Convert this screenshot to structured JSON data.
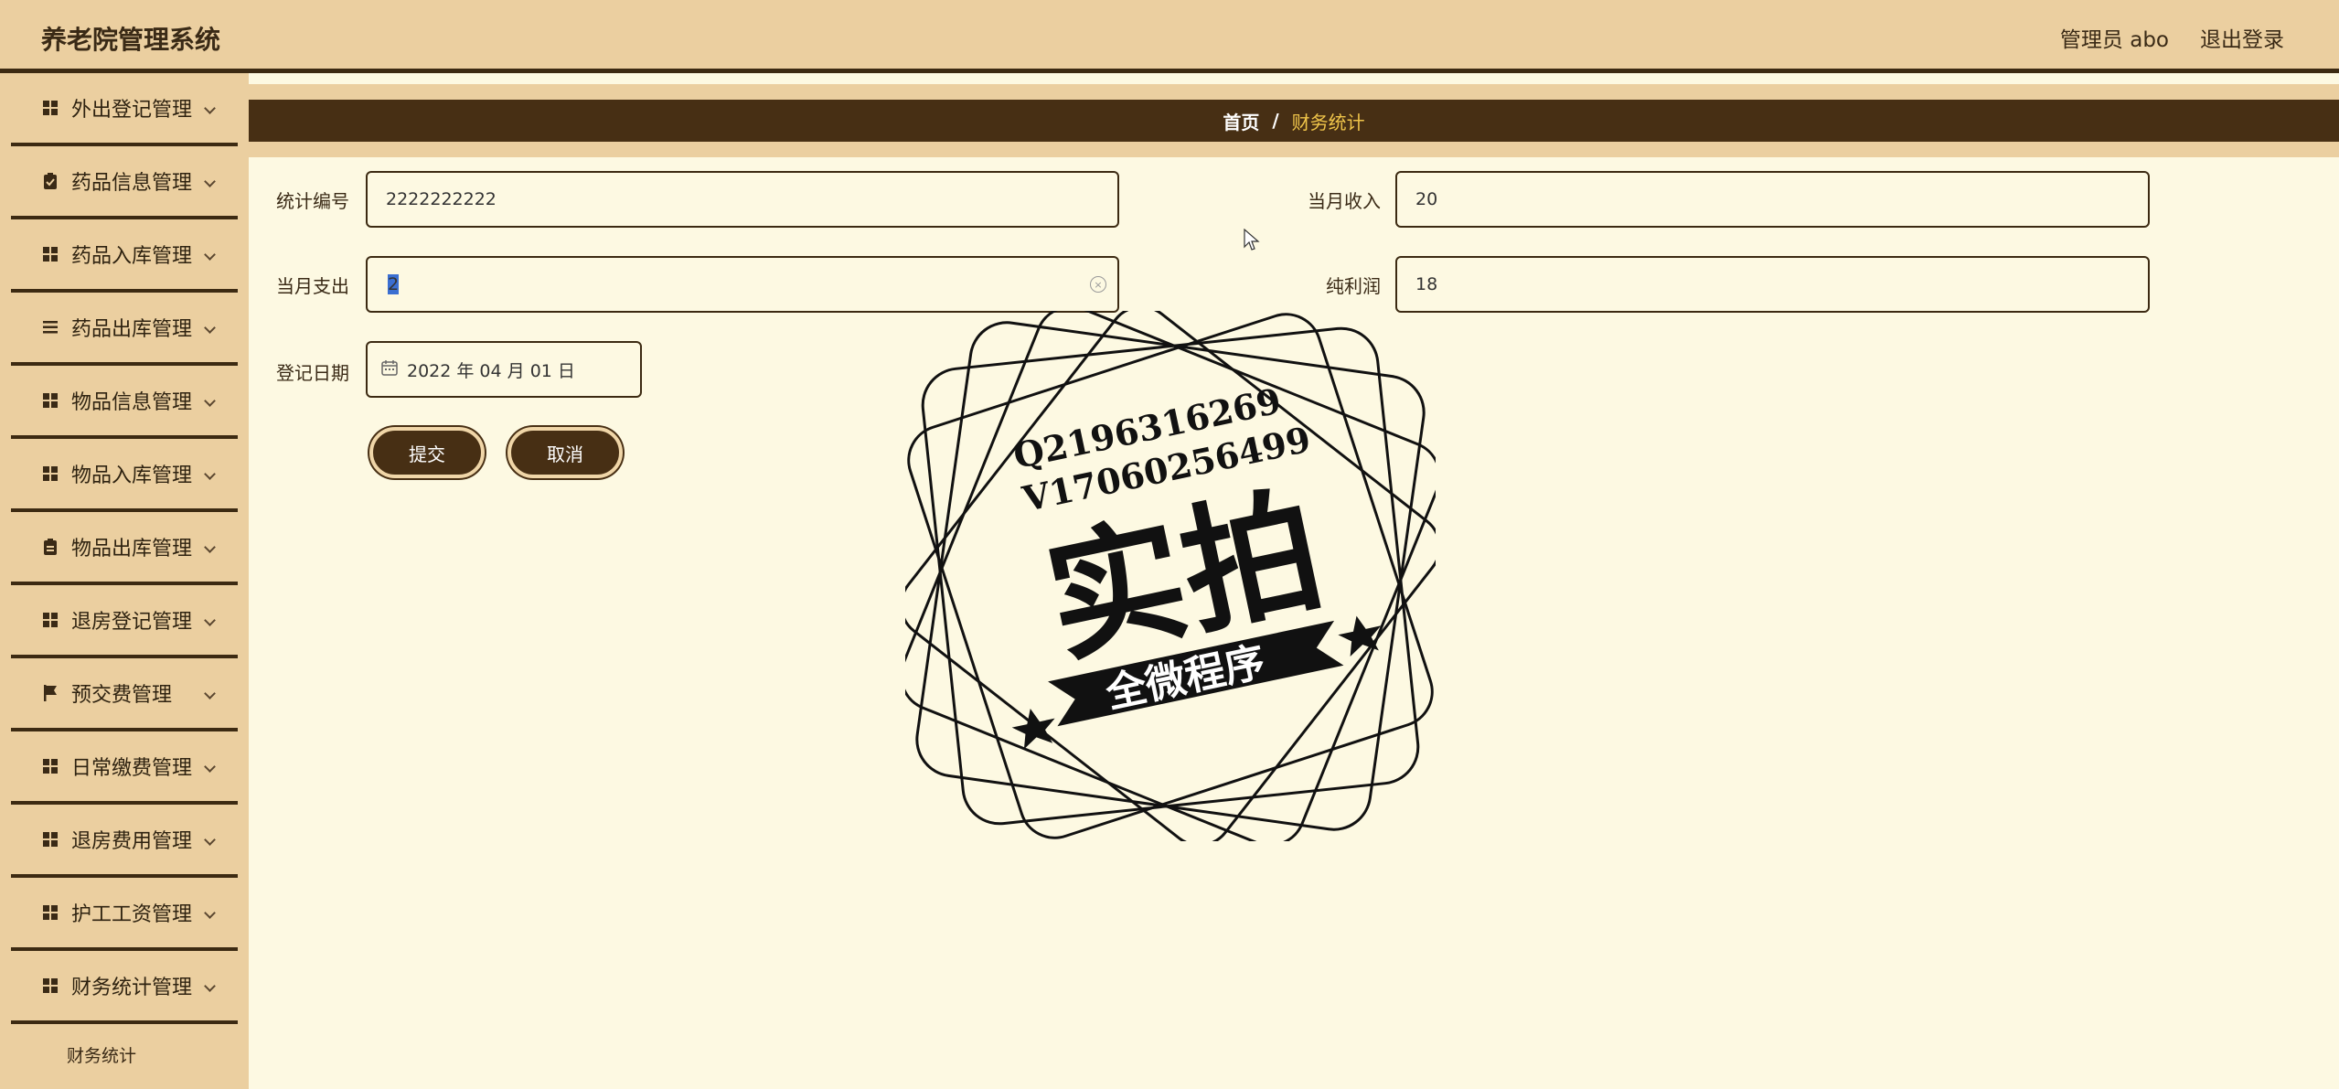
{
  "app": {
    "title": "养老院管理系统"
  },
  "header": {
    "user_label": "管理员 abo",
    "logout_label": "退出登录"
  },
  "sidebar": {
    "items": [
      {
        "label": "外出登记管理",
        "icon": "grid-icon"
      },
      {
        "label": "药品信息管理",
        "icon": "clipboard-check-icon"
      },
      {
        "label": "药品入库管理",
        "icon": "grid-icon"
      },
      {
        "label": "药品出库管理",
        "icon": "list-icon"
      },
      {
        "label": "物品信息管理",
        "icon": "grid-icon"
      },
      {
        "label": "物品入库管理",
        "icon": "grid-icon"
      },
      {
        "label": "物品出库管理",
        "icon": "clipboard-icon"
      },
      {
        "label": "退房登记管理",
        "icon": "grid-icon"
      },
      {
        "label": "预交费管理",
        "icon": "flag-icon"
      },
      {
        "label": "日常缴费管理",
        "icon": "grid-icon"
      },
      {
        "label": "退房费用管理",
        "icon": "grid-icon"
      },
      {
        "label": "护工工资管理",
        "icon": "grid-icon"
      },
      {
        "label": "财务统计管理",
        "icon": "grid-icon"
      }
    ],
    "sub_item": "财务统计"
  },
  "breadcrumb": {
    "home": "首页",
    "separator": "/",
    "current": "财务统计"
  },
  "form": {
    "stat_no_label": "统计编号",
    "stat_no_value": "2222222222",
    "income_label": "当月收入",
    "income_value": "20",
    "expense_label": "当月支出",
    "expense_value": "2",
    "profit_label": "纯利润",
    "profit_value": "18",
    "date_label": "登记日期",
    "date_value": "2022 年 04 月 01 日",
    "submit_label": "提交",
    "cancel_label": "取消"
  },
  "watermark": {
    "line1": "Q2196316269",
    "line2": "V17060256499",
    "big": "实拍",
    "banner": "全微程序"
  },
  "colors": {
    "header_bg": "#ebcfa0",
    "dark_brown": "#472f14",
    "page_bg": "#fdf9e2",
    "breadcrumb_current": "#f0c54a"
  }
}
